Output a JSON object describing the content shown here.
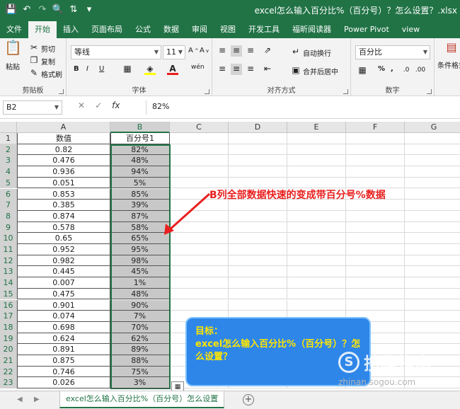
{
  "window_title": "excel怎么输入百分比%（百分号）？怎么设置？.xlsx",
  "qat": [
    "save-icon",
    "undo-icon",
    "redo-icon",
    "print-preview-icon",
    "sort-icon",
    "customize-icon"
  ],
  "tabs": [
    {
      "label": "文件",
      "active": false
    },
    {
      "label": "开始",
      "active": true
    },
    {
      "label": "插入",
      "active": false
    },
    {
      "label": "页面布局",
      "active": false
    },
    {
      "label": "公式",
      "active": false
    },
    {
      "label": "数据",
      "active": false
    },
    {
      "label": "审阅",
      "active": false
    },
    {
      "label": "视图",
      "active": false
    },
    {
      "label": "开发工具",
      "active": false
    },
    {
      "label": "福昕阅读器",
      "active": false
    },
    {
      "label": "Power Pivot",
      "active": false
    },
    {
      "label": "view",
      "active": false
    }
  ],
  "ribbon": {
    "clipboard": {
      "paste": "粘贴",
      "cut": "剪切",
      "copy": "复制",
      "format_painter": "格式刷",
      "label": "剪贴板"
    },
    "font": {
      "name": "等线",
      "size": "11",
      "bold": "B",
      "italic": "I",
      "underline": "U",
      "wen": "wén",
      "label": "字体"
    },
    "alignment": {
      "wrap": "自动换行",
      "merge": "合并后居中",
      "label": "对齐方式"
    },
    "number": {
      "format": "百分比",
      "percent": "%",
      "comma": ",",
      "label": "数字"
    },
    "styles": {
      "conditional": "条件格式"
    }
  },
  "formula_bar": {
    "name_box": "B2",
    "fx": "fx",
    "content": "82%"
  },
  "columns": [
    "A",
    "B",
    "C",
    "D",
    "E",
    "F",
    "G"
  ],
  "header_row": {
    "a": "数值",
    "b": "百分号1"
  },
  "rows": [
    {
      "a": "0.82",
      "b": "82%"
    },
    {
      "a": "0.476",
      "b": "48%"
    },
    {
      "a": "0.936",
      "b": "94%"
    },
    {
      "a": "0.051",
      "b": "5%"
    },
    {
      "a": "0.853",
      "b": "85%"
    },
    {
      "a": "0.385",
      "b": "39%"
    },
    {
      "a": "0.874",
      "b": "87%"
    },
    {
      "a": "0.578",
      "b": "58%"
    },
    {
      "a": "0.65",
      "b": "65%"
    },
    {
      "a": "0.952",
      "b": "95%"
    },
    {
      "a": "0.982",
      "b": "98%"
    },
    {
      "a": "0.445",
      "b": "45%"
    },
    {
      "a": "0.007",
      "b": "1%"
    },
    {
      "a": "0.475",
      "b": "48%"
    },
    {
      "a": "0.901",
      "b": "90%"
    },
    {
      "a": "0.074",
      "b": "7%"
    },
    {
      "a": "0.698",
      "b": "70%"
    },
    {
      "a": "0.624",
      "b": "62%"
    },
    {
      "a": "0.891",
      "b": "89%"
    },
    {
      "a": "0.875",
      "b": "88%"
    },
    {
      "a": "0.746",
      "b": "75%"
    },
    {
      "a": "0.026",
      "b": "3%"
    }
  ],
  "annotation": "B列全部数据快速的变成带百分号%数据",
  "goal": {
    "title": "目标：",
    "text": "excel怎么输入百分比%（百分号）？怎么设置？"
  },
  "watermark": {
    "text": "搜狗指南",
    "url": "zhinan.sogou.com"
  },
  "sheet_tab": "excel怎么输入百分比%（百分号）怎么设置",
  "colors": {
    "excel_green": "#217346",
    "annotation_red": "#e8201f",
    "goal_blue": "#2e86e8",
    "goal_text": "#ffe600"
  }
}
